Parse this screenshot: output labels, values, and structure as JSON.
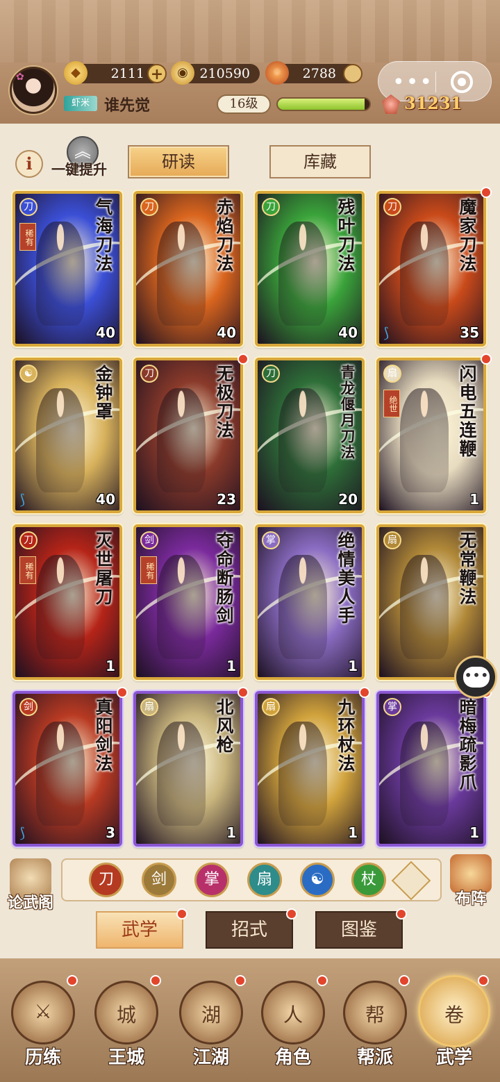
{
  "player": {
    "rank_tag": "虾米",
    "name": "谁先觉",
    "level": "16级",
    "xp_fraction": 0.95,
    "power": "31231"
  },
  "resources": {
    "gold": "2111",
    "coins": "210590",
    "fire": "2788"
  },
  "toolbar": {
    "upgrade_label": "一键提升",
    "tab_read": "研读",
    "tab_store": "库藏"
  },
  "cards": [
    {
      "name": "气海刀法",
      "count": "40",
      "rare": "稀有",
      "icon": "saber-icon",
      "color": "#3b4fd6",
      "frame": "gold",
      "dot": false,
      "water": false
    },
    {
      "name": "赤焰刀法",
      "count": "40",
      "rare": "",
      "icon": "saber-icon",
      "color": "#d9651e",
      "frame": "gold",
      "dot": false,
      "water": false
    },
    {
      "name": "残叶刀法",
      "count": "40",
      "rare": "",
      "icon": "saber-icon",
      "color": "#3aa33a",
      "frame": "gold",
      "dot": false,
      "water": false
    },
    {
      "name": "魔家刀法",
      "count": "35",
      "rare": "",
      "icon": "saber-icon",
      "color": "#c94a1a",
      "frame": "gold",
      "dot": true,
      "water": true
    },
    {
      "name": "金钟罩",
      "count": "40",
      "rare": "",
      "icon": "taiji-icon",
      "color": "#d8b25c",
      "frame": "gold",
      "dot": false,
      "water": true
    },
    {
      "name": "无极刀法",
      "count": "23",
      "rare": "",
      "icon": "saber-icon",
      "color": "#8a3a2a",
      "frame": "gold",
      "dot": true,
      "water": false
    },
    {
      "name": "青龙偃月刀法",
      "count": "20",
      "rare": "",
      "icon": "saber-icon",
      "color": "#2e6e38",
      "frame": "gold",
      "dot": false,
      "water": false
    },
    {
      "name": "闪电五连鞭",
      "count": "1",
      "rare": "绝世",
      "icon": "fan-icon",
      "color": "#e8dcc0",
      "frame": "gold",
      "dot": true,
      "water": false
    },
    {
      "name": "灭世屠刀",
      "count": "1",
      "rare": "稀有",
      "icon": "saber-icon",
      "color": "#b52418",
      "frame": "gold",
      "dot": false,
      "water": false
    },
    {
      "name": "夺命断肠剑",
      "count": "1",
      "rare": "稀有",
      "icon": "sword-icon",
      "color": "#7a2a9c",
      "frame": "gold",
      "dot": false,
      "water": false
    },
    {
      "name": "绝情美人手",
      "count": "1",
      "rare": "",
      "icon": "palm-icon",
      "color": "#8a6cc2",
      "frame": "gold",
      "dot": false,
      "water": false
    },
    {
      "name": "无常鞭法",
      "count": "",
      "rare": "",
      "icon": "fan-icon",
      "color": "#b08838",
      "frame": "gold",
      "dot": false,
      "water": false
    },
    {
      "name": "真阳剑法",
      "count": "3",
      "rare": "",
      "icon": "sword-icon",
      "color": "#b83a22",
      "frame": "purple",
      "dot": true,
      "water": true
    },
    {
      "name": "北风枪",
      "count": "1",
      "rare": "",
      "icon": "fan-icon",
      "color": "#c8b47c",
      "frame": "purple",
      "dot": true,
      "water": false
    },
    {
      "name": "九环杖法",
      "count": "1",
      "rare": "",
      "icon": "fan-icon",
      "color": "#d0a23c",
      "frame": "purple",
      "dot": true,
      "water": false
    },
    {
      "name": "暗梅疏影爪",
      "count": "1",
      "rare": "",
      "icon": "palm-icon",
      "color": "#6a3a9c",
      "frame": "purple",
      "dot": true,
      "water": false
    }
  ],
  "filters": [
    {
      "icon": "saber-icon",
      "color": "#b53a22",
      "glyph": "刀"
    },
    {
      "icon": "sword-icon",
      "color": "#9c7a3a",
      "glyph": "剑"
    },
    {
      "icon": "palm-icon",
      "color": "#b8306a",
      "glyph": "掌"
    },
    {
      "icon": "fan-icon",
      "color": "#2e8c8a",
      "glyph": "扇"
    },
    {
      "icon": "taiji-icon",
      "color": "#2a6cc4",
      "glyph": "☯"
    },
    {
      "icon": "staff-icon",
      "color": "#3a9a3a",
      "glyph": "杖"
    }
  ],
  "side": {
    "left_label": "论武阁",
    "right_label": "布阵"
  },
  "subtabs": [
    "武学",
    "招式",
    "图鉴"
  ],
  "nav": [
    {
      "label": "历练",
      "icon": "sword-icon",
      "glyph": "⚔"
    },
    {
      "label": "王城",
      "icon": "castle-icon",
      "glyph": "城"
    },
    {
      "label": "江湖",
      "icon": "pouch-icon",
      "glyph": "湖"
    },
    {
      "label": "角色",
      "icon": "hat-icon",
      "glyph": "人"
    },
    {
      "label": "帮派",
      "icon": "emblem-icon",
      "glyph": "帮"
    },
    {
      "label": "武学",
      "icon": "scroll-icon",
      "glyph": "卷"
    }
  ]
}
